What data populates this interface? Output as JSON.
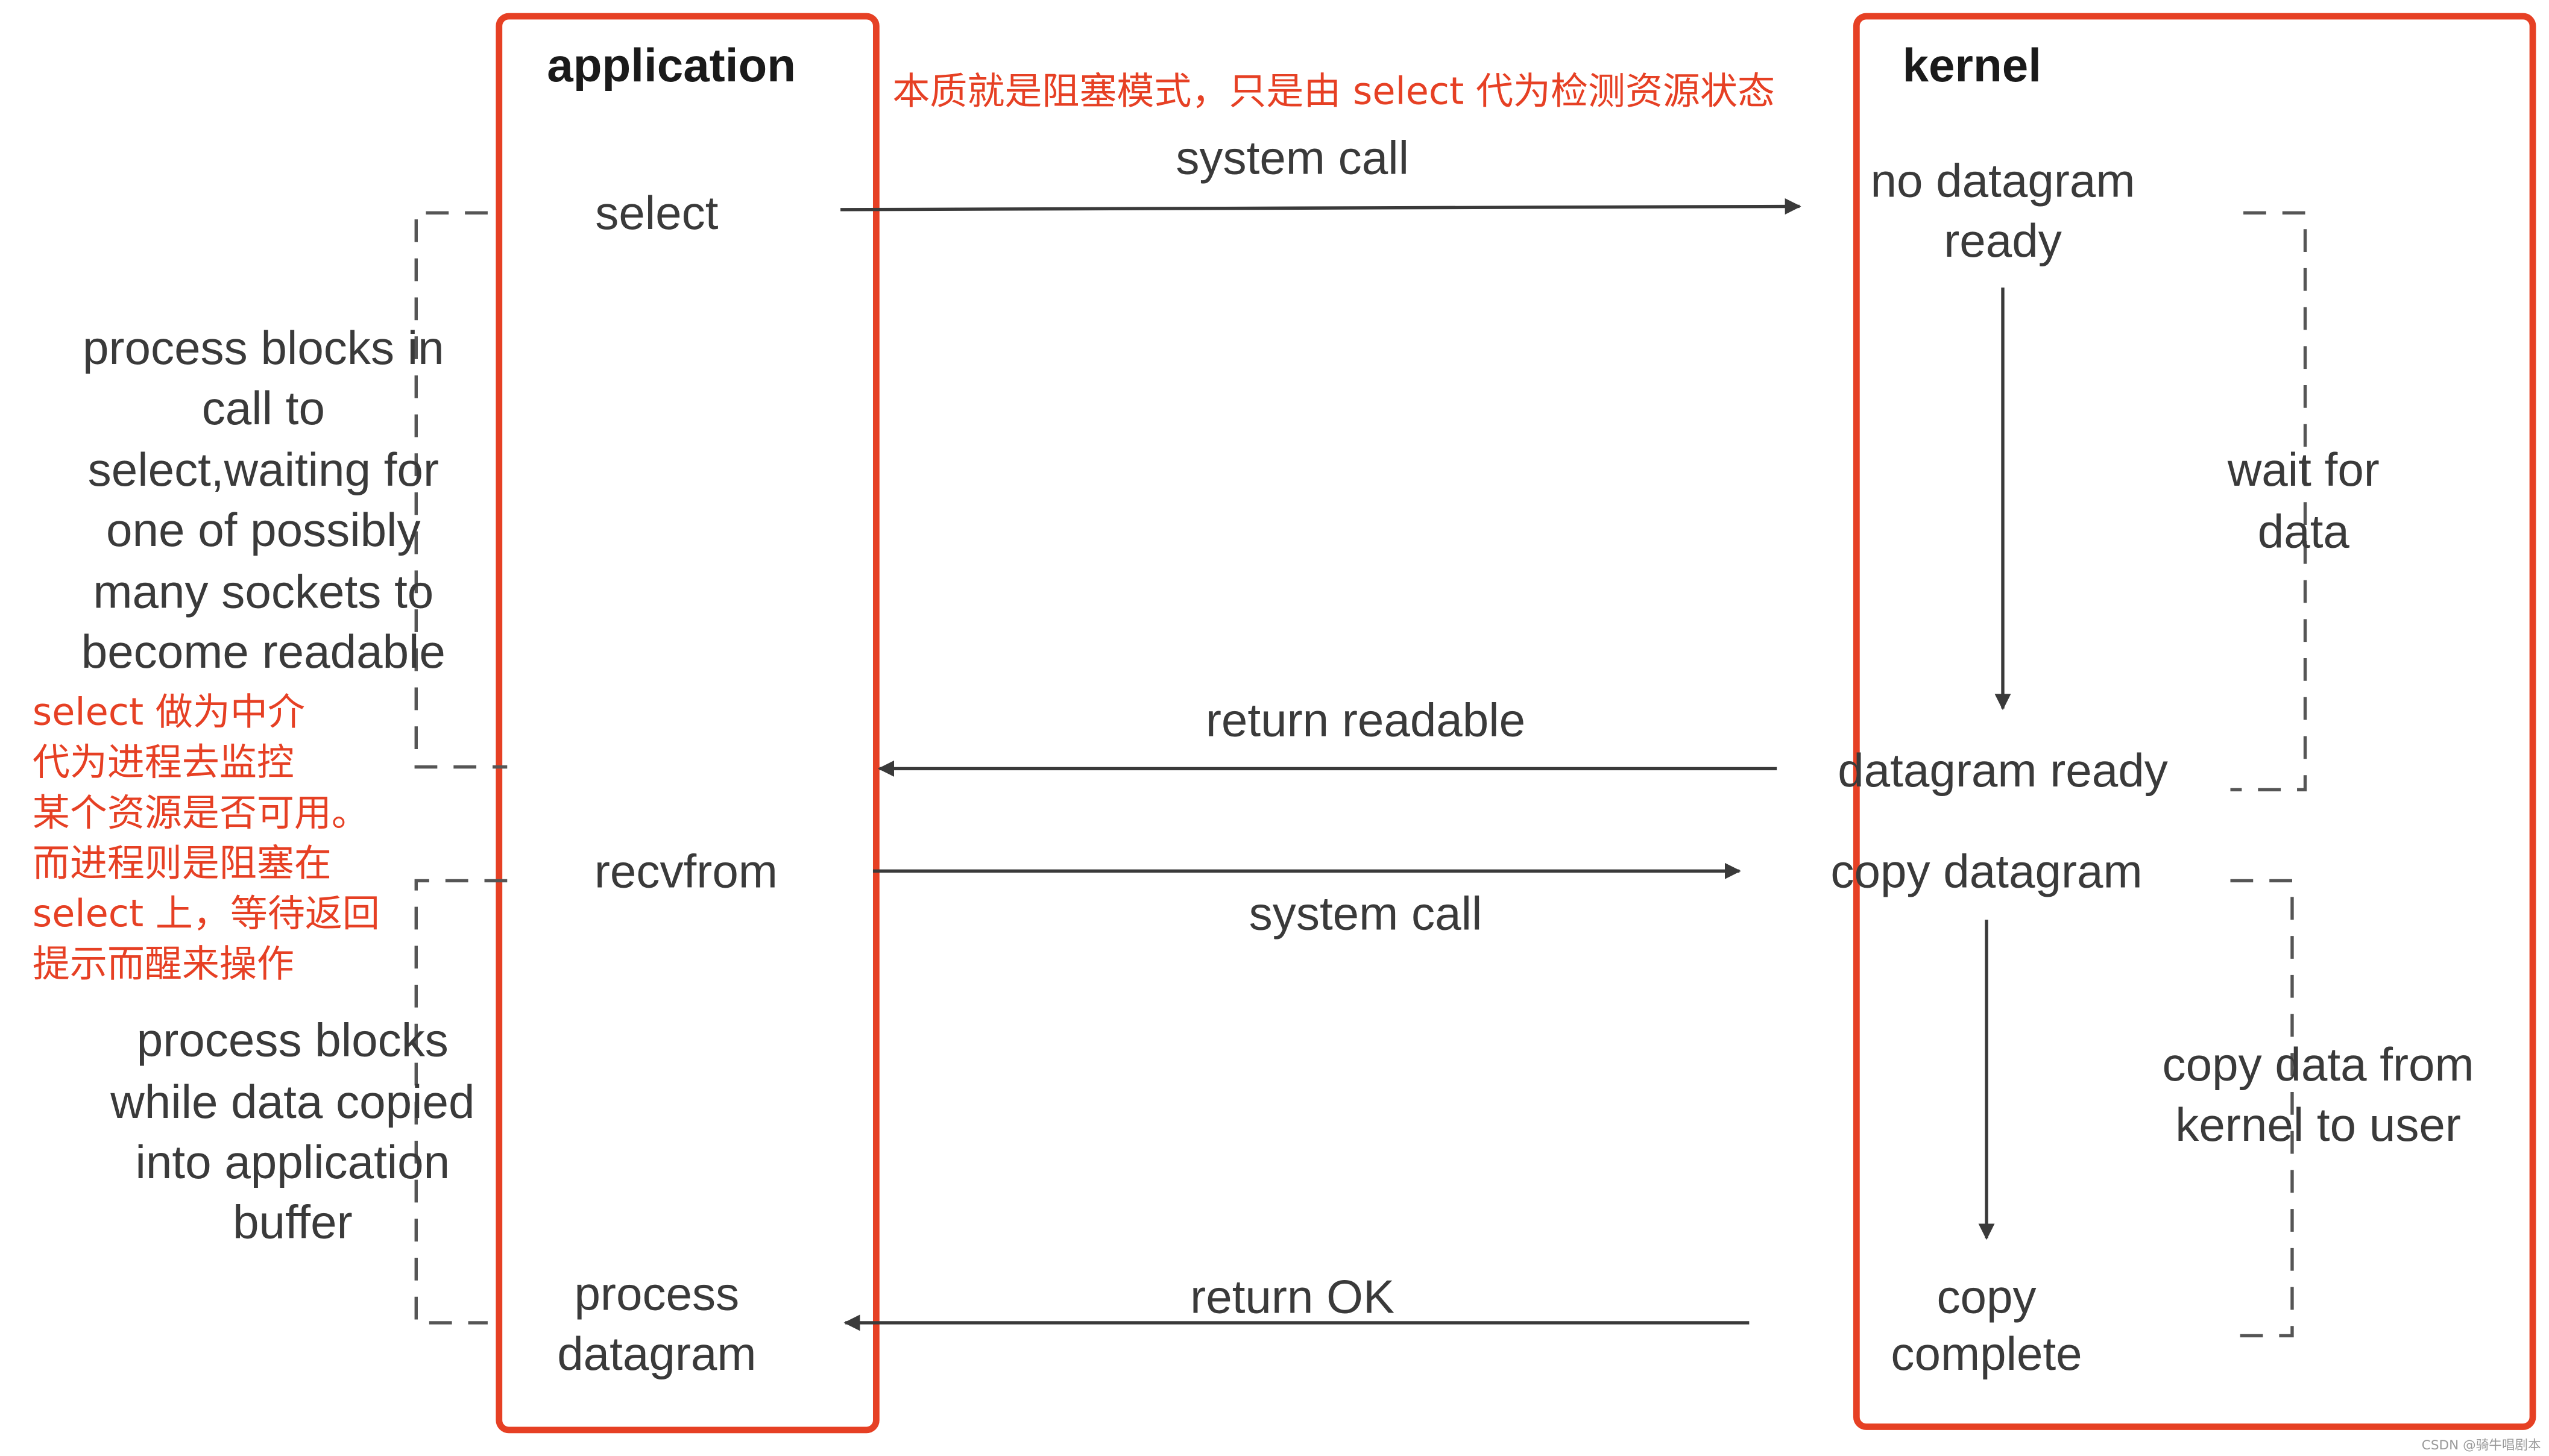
{
  "columns": {
    "application": "application",
    "kernel": "kernel"
  },
  "annotation_top": "本质就是阻塞模式，只是由 select 代为检测资源状态",
  "annotation_left": [
    "select 做为中介",
    "代为进程去监控",
    "某个资源是否可用。",
    "而进程则是阻塞在",
    "select 上，等待返回",
    "提示而醒来操作"
  ],
  "app_steps": {
    "select": "select",
    "recvfrom": "recvfrom",
    "process_datagram": [
      "process",
      "datagram"
    ]
  },
  "kernel_steps": {
    "no_datagram_ready": [
      "no datagram",
      "ready"
    ],
    "datagram_ready": "datagram ready",
    "copy_datagram": "copy datagram",
    "copy_complete": [
      "copy",
      "complete"
    ]
  },
  "arrows": {
    "system_call_1": "system call",
    "return_readable": "return readable",
    "system_call_2": "system call",
    "return_ok": "return OK"
  },
  "left_notes": {
    "blocks_select": [
      "process blocks in",
      "call to",
      "select,waiting for",
      "one of possibly",
      "many sockets to",
      "become readable"
    ],
    "blocks_copy": [
      "process blocks",
      "while data copied",
      "into application",
      "buffer"
    ]
  },
  "right_notes": {
    "wait_for_data": [
      "wait for",
      "data"
    ],
    "copy_data": [
      "copy data from",
      "kernel to user"
    ]
  },
  "watermark": "CSDN @骑牛唱剧本",
  "colors": {
    "annotation": "#e64024",
    "text": "#3a3a3a"
  }
}
